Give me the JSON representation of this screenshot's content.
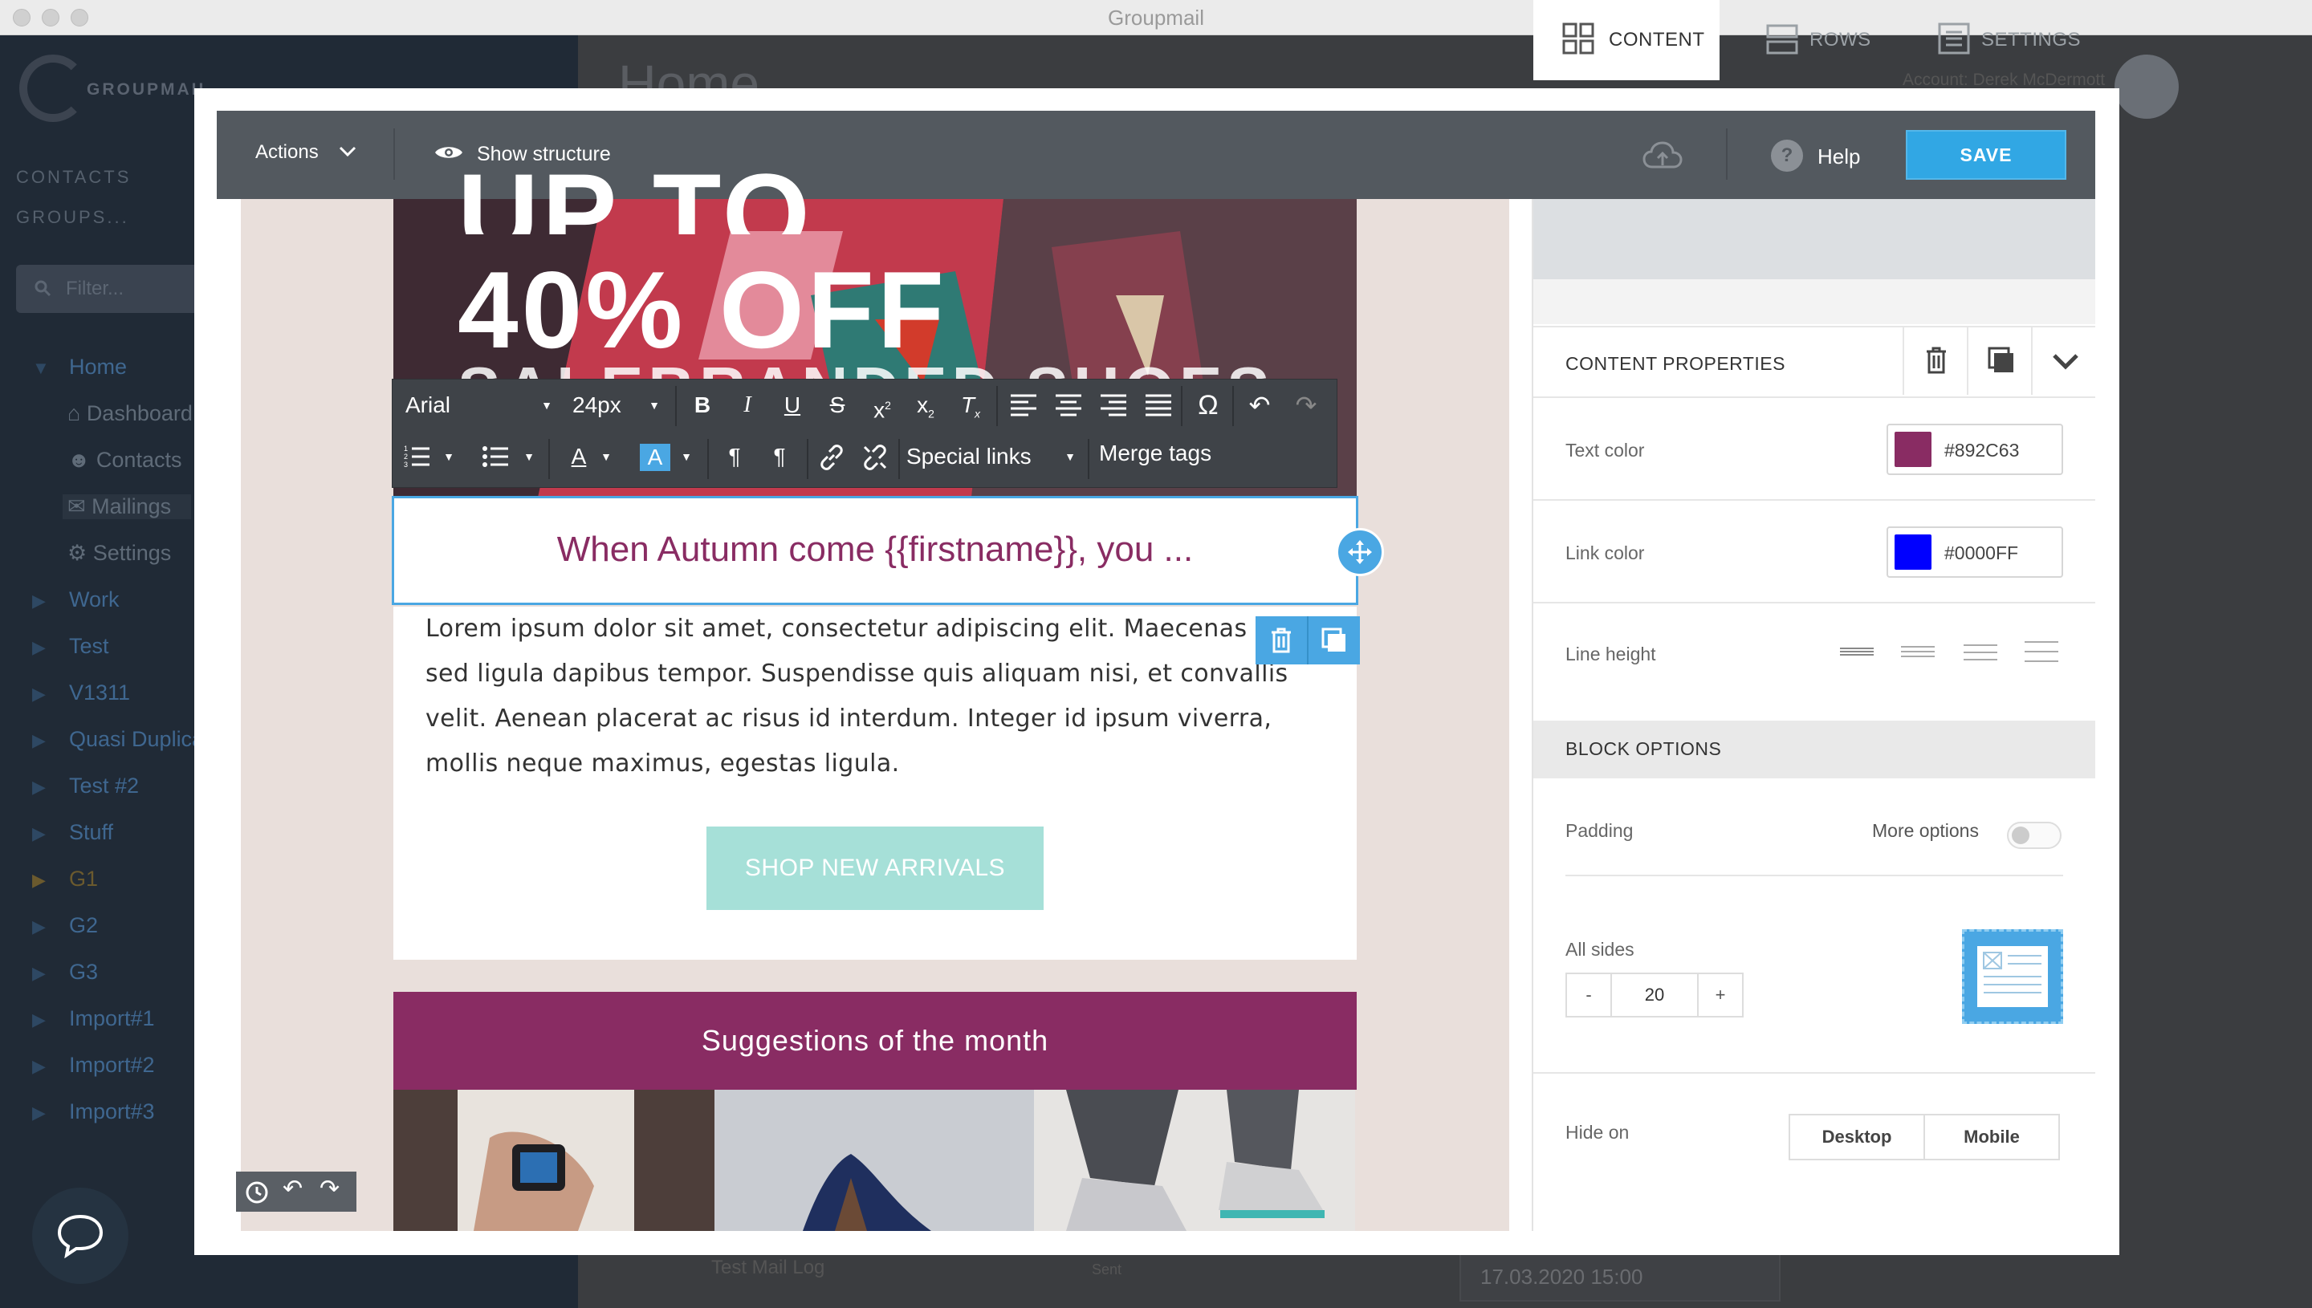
{
  "window": {
    "title": "Groupmail"
  },
  "background_app": {
    "logo_text": "GROUPMAIL",
    "nav_headers": [
      "CONTACTS",
      "GROUPS..."
    ],
    "filter_placeholder": "Filter...",
    "tree": [
      {
        "label": "Home",
        "children": [
          "Dashboard",
          "Contacts",
          "Mailings",
          "Settings"
        ]
      },
      {
        "label": "Work"
      },
      {
        "label": "Test"
      },
      {
        "label": "V1311"
      },
      {
        "label": "Quasi Duplicate"
      },
      {
        "label": "Test #2"
      },
      {
        "label": "Stuff"
      },
      {
        "label": "G1"
      },
      {
        "label": "G2"
      },
      {
        "label": "G3"
      },
      {
        "label": "Import#1"
      },
      {
        "label": "Import#2"
      },
      {
        "label": "Import#3"
      }
    ],
    "page_title": "Home",
    "account": "Account: Derek McDermott",
    "list_item": "Test Mail Log",
    "list_status": "Sent",
    "list_date": "17.03.2020 15:00"
  },
  "editor": {
    "toolbar": {
      "actions_label": "Actions",
      "show_structure_label": "Show structure",
      "help_label": "Help",
      "save_label": "SAVE"
    },
    "hero": {
      "line1": "UP TO",
      "line2": "40% OFF",
      "line3": "SALEBRANDED SHOES"
    },
    "text_toolbar": {
      "font": "Arial",
      "size": "24px",
      "special_links": "Special links",
      "merge_tags": "Merge tags"
    },
    "headline": "When Autumn come {{firstname}}, you ...",
    "body_text": "Lorem ipsum dolor sit amet, consectetur adipiscing elit. Maecenas urna sed ligula dapibus tempor. Suspendisse quis aliquam nisi, et convallis velit. Aenean placerat ac risus id interdum. Integer id ipsum viverra, mollis neque maximus, egestas ligula.",
    "cta_button": "SHOP NEW ARRIVALS",
    "section_title": "Suggestions of the month"
  },
  "panel": {
    "tabs": [
      "CONTENT",
      "ROWS",
      "SETTINGS"
    ],
    "content_properties_label": "CONTENT PROPERTIES",
    "text_color_label": "Text color",
    "text_color": "#892C63",
    "link_color_label": "Link color",
    "link_color": "#0000FF",
    "line_height_label": "Line height",
    "block_options_label": "BLOCK OPTIONS",
    "padding_label": "Padding",
    "more_options_label": "More options",
    "all_sides_label": "All sides",
    "padding_value": "20",
    "minus": "-",
    "plus": "+",
    "hide_on_label": "Hide on",
    "hide_on_options": [
      "Desktop",
      "Mobile"
    ]
  },
  "colors": {
    "accent": "#31a7e4",
    "brand": "#892c63",
    "cta": "#a6e0d8"
  }
}
